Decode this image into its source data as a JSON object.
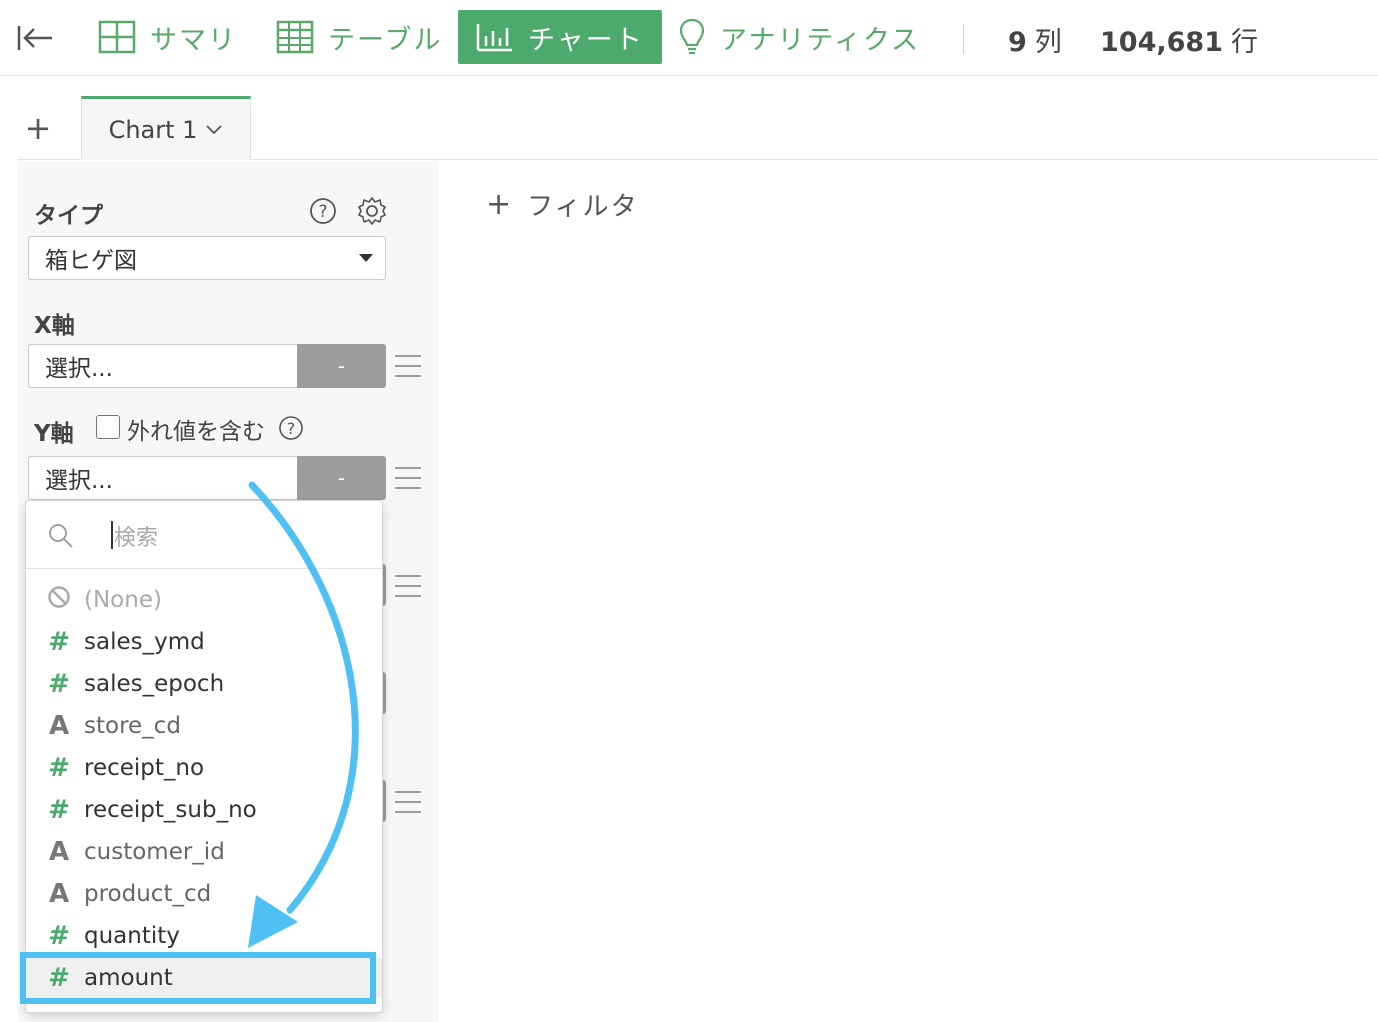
{
  "topbar": {
    "nav": [
      {
        "label": "サマリ",
        "icon": "summary-grid-icon"
      },
      {
        "label": "テーブル",
        "icon": "table-icon"
      },
      {
        "label": "チャート",
        "icon": "bar-chart-icon",
        "active": true
      },
      {
        "label": "アナリティクス",
        "icon": "lightbulb-icon"
      }
    ],
    "columns_count": "9",
    "columns_unit": "列",
    "rows_count": "104,681",
    "rows_unit": "行"
  },
  "tabs": {
    "add_label": "+",
    "chart_tab_label": "Chart 1"
  },
  "panel": {
    "type_label": "タイプ",
    "type_value": "箱ヒゲ図",
    "x_axis_label": "X軸",
    "x_axis_value": "選択...",
    "x_axis_button": "-",
    "y_axis_label": "Y軸",
    "outlier_label": "外れ値を含む",
    "y_axis_value": "選択...",
    "y_axis_button": "-"
  },
  "filter": {
    "label": "フィルタ"
  },
  "dropdown": {
    "search_placeholder": "検索",
    "items": [
      {
        "label": "(None)",
        "type": "none"
      },
      {
        "label": "sales_ymd",
        "type": "number"
      },
      {
        "label": "sales_epoch",
        "type": "number"
      },
      {
        "label": "store_cd",
        "type": "string"
      },
      {
        "label": "receipt_no",
        "type": "number"
      },
      {
        "label": "receipt_sub_no",
        "type": "number"
      },
      {
        "label": "customer_id",
        "type": "string"
      },
      {
        "label": "product_cd",
        "type": "string"
      },
      {
        "label": "quantity",
        "type": "number"
      },
      {
        "label": "amount",
        "type": "number",
        "highlighted": true
      }
    ],
    "type_glyphs": {
      "number": "#",
      "string": "A"
    }
  },
  "colors": {
    "accent_green": "#4caa6d",
    "annotation_blue": "#4fc0f3"
  }
}
